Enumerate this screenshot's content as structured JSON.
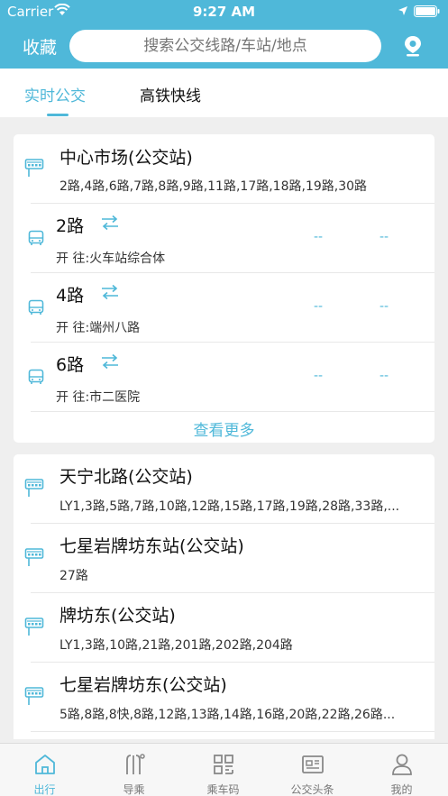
{
  "status_bar": {
    "carrier": "Carrier",
    "time": "9:27 AM"
  },
  "header": {
    "favorites_label": "收藏",
    "search_placeholder": "搜索公交线路/车站/地点"
  },
  "tabs": [
    {
      "label": "实时公交",
      "active": true
    },
    {
      "label": "高铁快线",
      "active": false
    }
  ],
  "card1": {
    "stop": {
      "name": "中心市场(公交站)",
      "lines": "2路,4路,6路,7路,8路,9路,11路,17路,18路,19路,30路"
    },
    "routes": [
      {
        "name": "2路",
        "direction": "开  往:火车站综合体",
        "eta1": "--",
        "eta2": "--"
      },
      {
        "name": "4路",
        "direction": "开  往:端州八路",
        "eta1": "--",
        "eta2": "--"
      },
      {
        "name": "6路",
        "direction": "开  往:市二医院",
        "eta1": "--",
        "eta2": "--"
      }
    ],
    "more_label": "查看更多"
  },
  "card2": {
    "stops": [
      {
        "name": "天宁北路(公交站)",
        "lines": "LY1,3路,5路,7路,10路,12路,15路,17路,19路,28路,33路,..."
      },
      {
        "name": "七星岩牌坊东站(公交站)",
        "lines": "27路"
      },
      {
        "name": "牌坊东(公交站)",
        "lines": "LY1,3路,10路,21路,201路,202路,204路"
      },
      {
        "name": "七星岩牌坊东(公交站)",
        "lines": "5路,8路,8快,8路,12路,13路,14路,16路,20路,22路,26路..."
      }
    ]
  },
  "tabbar": [
    {
      "label": "出行",
      "icon": "home-icon",
      "active": true
    },
    {
      "label": "导乘",
      "icon": "route-guide-icon",
      "active": false
    },
    {
      "label": "乘车码",
      "icon": "qr-code-icon",
      "active": false
    },
    {
      "label": "公交头条",
      "icon": "news-icon",
      "active": false
    },
    {
      "label": "我的",
      "icon": "profile-icon",
      "active": false
    }
  ],
  "colors": {
    "accent": "#4fb8d9",
    "background": "#efefef"
  }
}
